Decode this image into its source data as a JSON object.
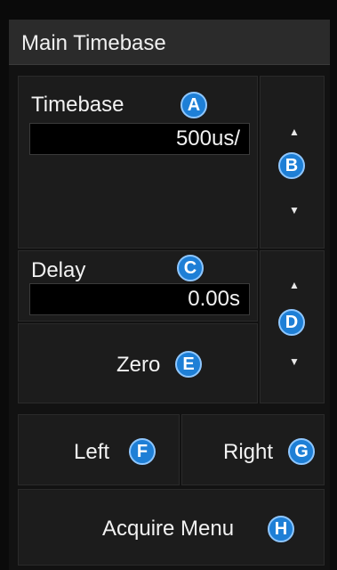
{
  "header": {
    "title": "Main Timebase"
  },
  "timebase": {
    "label": "Timebase",
    "value": "500us/",
    "badge": "A",
    "adjust_badge": "B"
  },
  "delay": {
    "label": "Delay",
    "value": "0.00s",
    "badge": "C",
    "adjust_badge": "D"
  },
  "buttons": {
    "zero": {
      "label": "Zero",
      "badge": "E"
    },
    "left": {
      "label": "Left",
      "badge": "F"
    },
    "right": {
      "label": "Right",
      "badge": "G"
    },
    "acquire": {
      "label": "Acquire Menu",
      "badge": "H"
    }
  },
  "icons": {
    "up": "arrow-up-icon",
    "down": "arrow-down-icon"
  },
  "colors": {
    "badge": "#1e7fd6",
    "background": "#0b0b0b",
    "panel": "#1c1c1c"
  }
}
